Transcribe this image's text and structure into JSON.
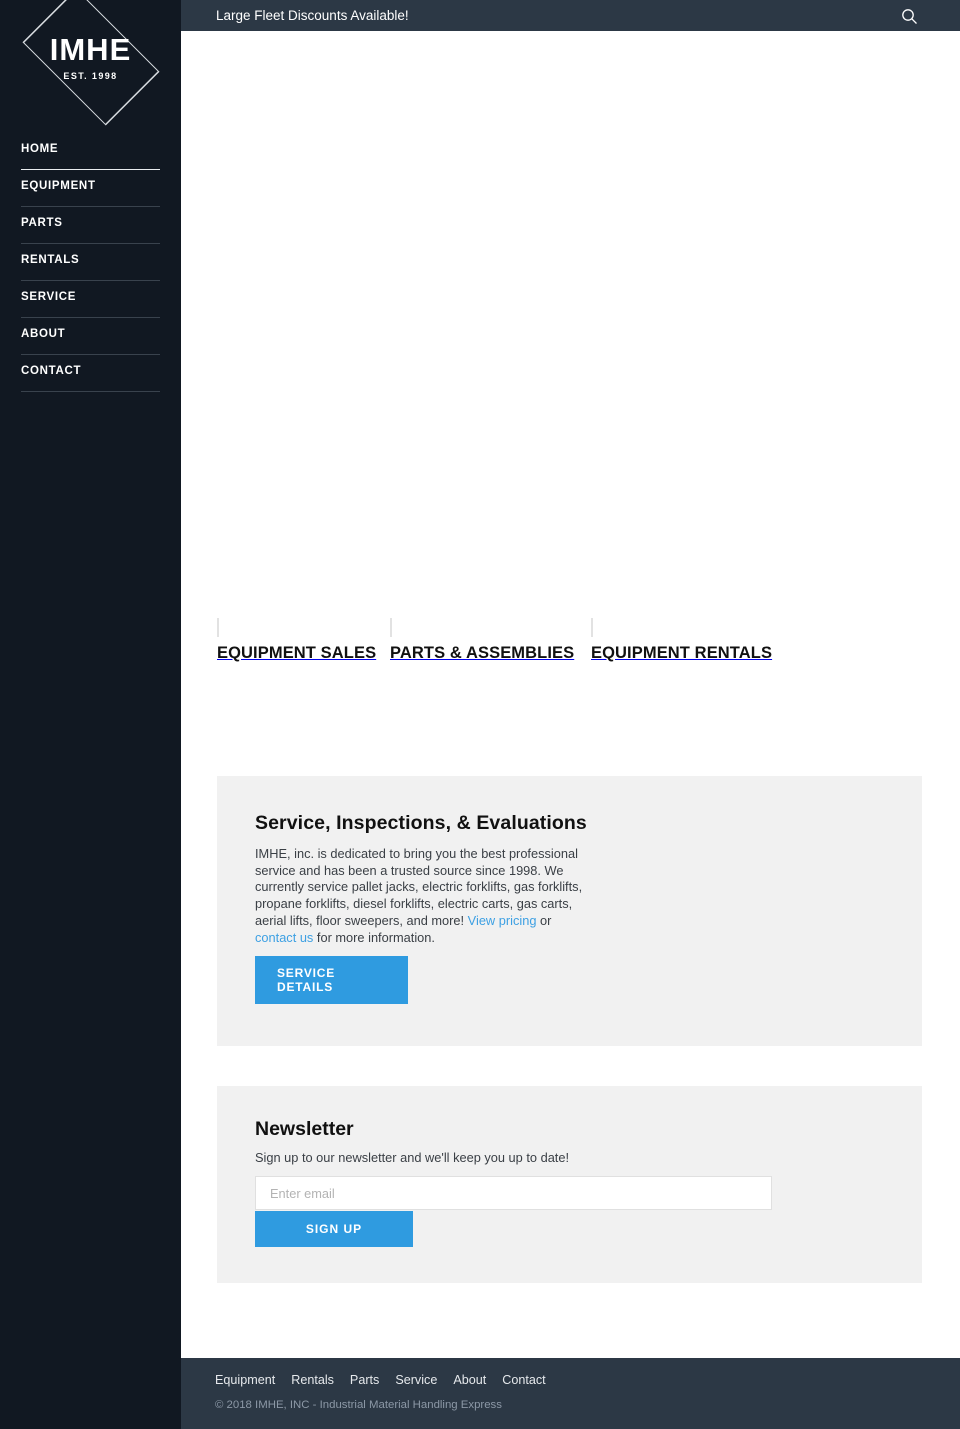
{
  "sidebar": {
    "logo": {
      "name": "IMHE",
      "established": "EST. 1998",
      "icon": "diamond-outline-icon"
    },
    "items": [
      {
        "label": "HOME",
        "active": true
      },
      {
        "label": "EQUIPMENT",
        "active": false
      },
      {
        "label": "PARTS",
        "active": false
      },
      {
        "label": "RENTALS",
        "active": false
      },
      {
        "label": "SERVICE",
        "active": false
      },
      {
        "label": "ABOUT",
        "active": false
      },
      {
        "label": "CONTACT",
        "active": false
      }
    ]
  },
  "topbar": {
    "announcement": "Large Fleet Discounts Available!",
    "search_icon": "search-icon"
  },
  "categories": [
    {
      "label": "EQUIPMENT SALES"
    },
    {
      "label": "PARTS & ASSEMBLIES"
    },
    {
      "label": "EQUIPMENT RENTALS"
    }
  ],
  "service": {
    "title": "Service, Inspections, & Evaluations",
    "body_1": "IMHE, inc. is dedicated to bring you the best professional service and has been a trusted source since 1998. We currently service pallet jacks, electric forklifts, gas forklifts, propane forklifts, diesel forklifts, electric carts, gas carts, aerial lifts, floor sweepers, and more! ",
    "link_pricing": "View pricing",
    "body_2": " or ",
    "link_contact": "contact us",
    "body_3": " for more information.",
    "button_line_1": "SERVICE",
    "button_line_2": "DETAILS"
  },
  "newsletter": {
    "title": "Newsletter",
    "subtitle": "Sign up to our newsletter and we'll keep you up to date!",
    "email_placeholder": "Enter email",
    "email_value": "",
    "signup_label": "SIGN UP"
  },
  "footer": {
    "links": [
      "Equipment",
      "Rentals",
      "Parts",
      "Service",
      "About",
      "Contact"
    ],
    "copyright": "© 2018 IMHE, INC - Industrial Material Handling Express"
  },
  "colors": {
    "sidebar_bg": "#111822",
    "bar_bg": "#2c3845",
    "accent_blue": "#2f9be0",
    "link_blue": "#3da0e3",
    "panel_bg": "#f1f1f1"
  }
}
